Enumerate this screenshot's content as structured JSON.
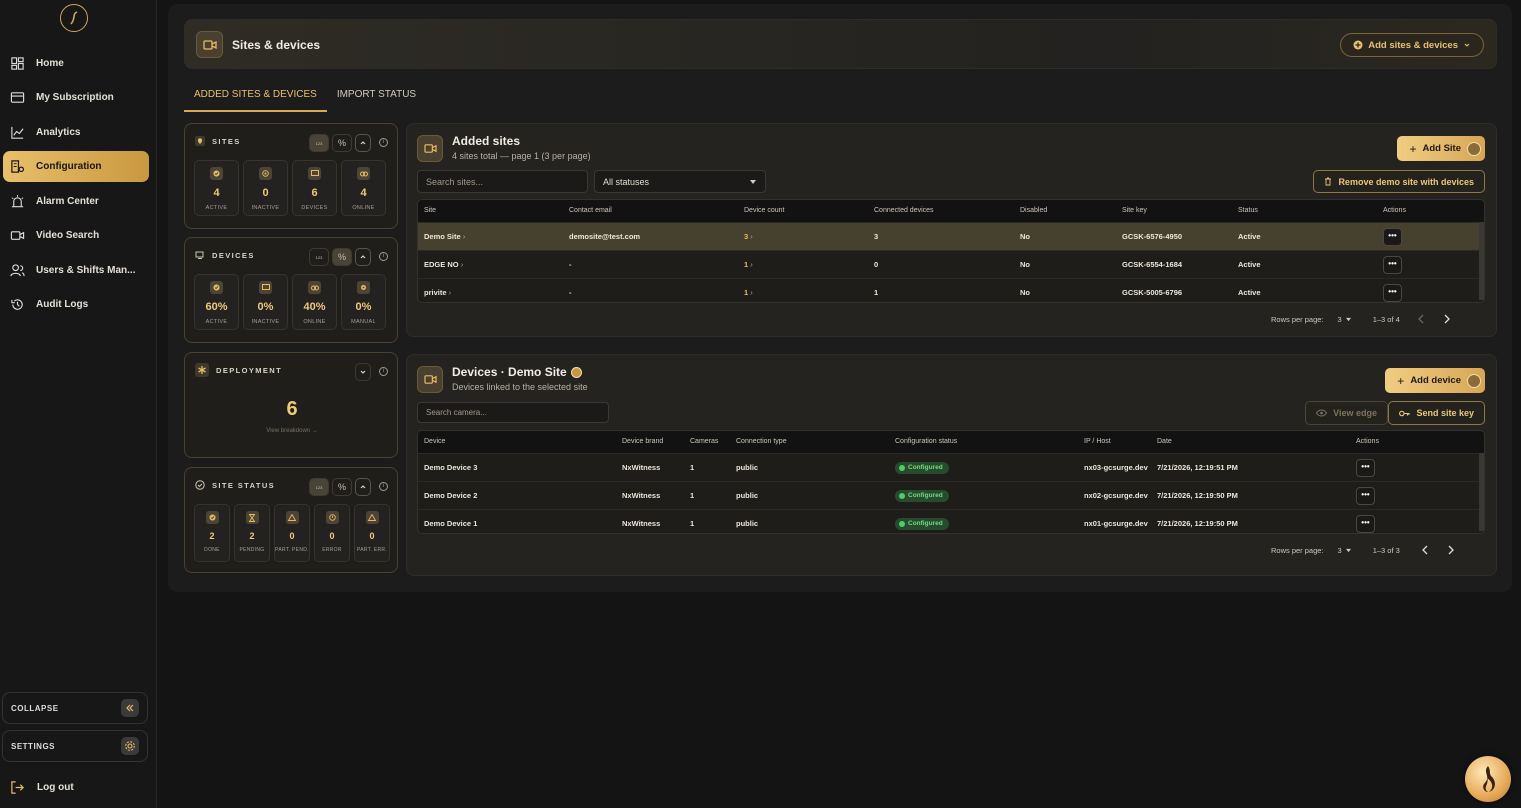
{
  "sidebar": {
    "items": [
      {
        "label": "Home",
        "icon": "dashboard-icon"
      },
      {
        "label": "My Subscription",
        "icon": "card-icon"
      },
      {
        "label": "Analytics",
        "icon": "chart-line-icon"
      },
      {
        "label": "Configuration",
        "icon": "building-gear-icon",
        "active": true
      },
      {
        "label": "Alarm Center",
        "icon": "alarm-icon"
      },
      {
        "label": "Video Search",
        "icon": "video-icon"
      },
      {
        "label": "Users & Shifts Man...",
        "icon": "users-icon"
      },
      {
        "label": "Audit Logs",
        "icon": "history-icon"
      }
    ],
    "collapse_label": "COLLAPSE",
    "settings_label": "SETTINGS",
    "logout_label": "Log out"
  },
  "header": {
    "title": "Sites & devices",
    "add_button": "Add sites & devices"
  },
  "tabs": [
    {
      "label": "ADDED SITES & DEVICES",
      "active": true
    },
    {
      "label": "IMPORT STATUS",
      "active": false
    }
  ],
  "sites_card": {
    "title": "SITES",
    "toggle_num": "123",
    "toggle_pct": "%",
    "tiles": [
      {
        "value": "4",
        "label": "ACTIVE"
      },
      {
        "value": "0",
        "label": "INACTIVE"
      },
      {
        "value": "6",
        "label": "DEVICES"
      },
      {
        "value": "4",
        "label": "ONLINE"
      }
    ]
  },
  "devices_card": {
    "title": "DEVICES",
    "toggle_num": "123",
    "toggle_pct": "%",
    "tiles": [
      {
        "value": "60%",
        "label": "ACTIVE"
      },
      {
        "value": "0%",
        "label": "INACTIVE"
      },
      {
        "value": "40%",
        "label": "ONLINE"
      },
      {
        "value": "0%",
        "label": "MANUAL"
      }
    ]
  },
  "deployment_card": {
    "title": "DEPLOYMENT",
    "value": "6",
    "link": "View breakdown →"
  },
  "site_status_card": {
    "title": "SITE STATUS",
    "toggle_num": "123",
    "toggle_pct": "%",
    "tiles": [
      {
        "value": "2",
        "label": "DONE"
      },
      {
        "value": "2",
        "label": "PENDING"
      },
      {
        "value": "0",
        "label": "PART. PEND."
      },
      {
        "value": "0",
        "label": "ERROR"
      },
      {
        "value": "0",
        "label": "PART. ERR."
      }
    ]
  },
  "added_sites": {
    "title": "Added sites",
    "subtitle": "4 sites total — page 1 (3 per page)",
    "add_button": "Add Site",
    "remove_button": "Remove demo site with devices",
    "search_placeholder": "Search sites...",
    "status_filter": "All statuses",
    "columns": [
      "Site",
      "Contact email",
      "Device count",
      "Connected devices",
      "Disabled",
      "Site key",
      "Status",
      "Actions"
    ],
    "rows": [
      {
        "site": "Demo Site",
        "email": "demosite@test.com",
        "count": "3",
        "connected": "3",
        "disabled": "No",
        "key": "GCSK-6576-4950",
        "status": "Active",
        "selected": true
      },
      {
        "site": "EDGE NO",
        "email": "-",
        "count": "1",
        "connected": "0",
        "disabled": "No",
        "key": "GCSK-6554-1684",
        "status": "Active"
      },
      {
        "site": "privite",
        "email": "-",
        "count": "1",
        "connected": "1",
        "disabled": "No",
        "key": "GCSK-5005-6796",
        "status": "Active"
      }
    ],
    "rows_per_page_label": "Rows per page:",
    "rows_per_page": "3",
    "range": "1–3 of 4"
  },
  "devices": {
    "title": "Devices · Demo Site",
    "subtitle": "Devices linked to the selected site",
    "add_button": "Add device",
    "view_edge": "View edge",
    "send_key": "Send site key",
    "search_placeholder": "Search camera...",
    "columns": [
      "Device",
      "Device brand",
      "Cameras",
      "Connection type",
      "Configuration status",
      "IP / Host",
      "Date",
      "Actions"
    ],
    "rows": [
      {
        "device": "Demo Device 3",
        "brand": "NxWitness",
        "cameras": "1",
        "conn": "public",
        "status": "Configured",
        "host": "nx03-gcsurge.dev",
        "date": "7/21/2026, 12:19:51 PM"
      },
      {
        "device": "Demo Device 2",
        "brand": "NxWitness",
        "cameras": "1",
        "conn": "public",
        "status": "Configured",
        "host": "nx02-gcsurge.dev",
        "date": "7/21/2026, 12:19:50 PM"
      },
      {
        "device": "Demo Device 1",
        "brand": "NxWitness",
        "cameras": "1",
        "conn": "public",
        "status": "Configured",
        "host": "nx01-gcsurge.dev",
        "date": "7/21/2026, 12:19:50 PM"
      }
    ],
    "rows_per_page_label": "Rows per page:",
    "rows_per_page": "3",
    "range": "1–3 of 3"
  },
  "colors": {
    "accent": "#e8bf6a",
    "success": "#4fcf63",
    "background": "#141414"
  }
}
